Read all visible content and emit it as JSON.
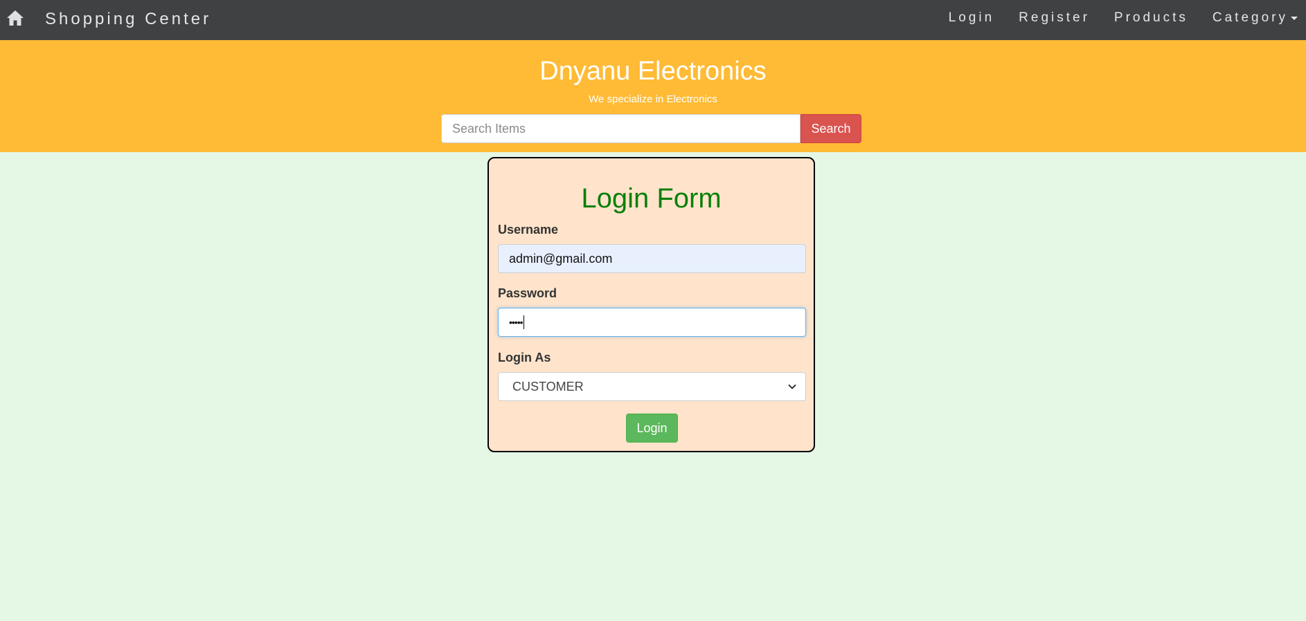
{
  "navbar": {
    "brand": "Shopping Center",
    "home_icon": "home-icon",
    "links": [
      "Login",
      "Register",
      "Products",
      "Category"
    ]
  },
  "banner": {
    "title": "Dnyanu Electronics",
    "tagline": "We specialize in Electronics",
    "search_placeholder": "Search Items",
    "search_button": "Search"
  },
  "login_form": {
    "title": "Login Form",
    "username_label": "Username",
    "username_value": "admin@gmail.com",
    "password_label": "Password",
    "password_masked": "•••••",
    "login_as_label": "Login As",
    "login_as_selected": "CUSTOMER",
    "submit_label": "Login"
  },
  "colors": {
    "navbar_bg": "#404143",
    "banner_bg": "#ffbb36",
    "page_bg": "#e5f8e5",
    "card_bg": "#ffe4cb",
    "title_green": "#0a7f0a",
    "search_red": "#d9534f",
    "login_green": "#5cb85c"
  }
}
